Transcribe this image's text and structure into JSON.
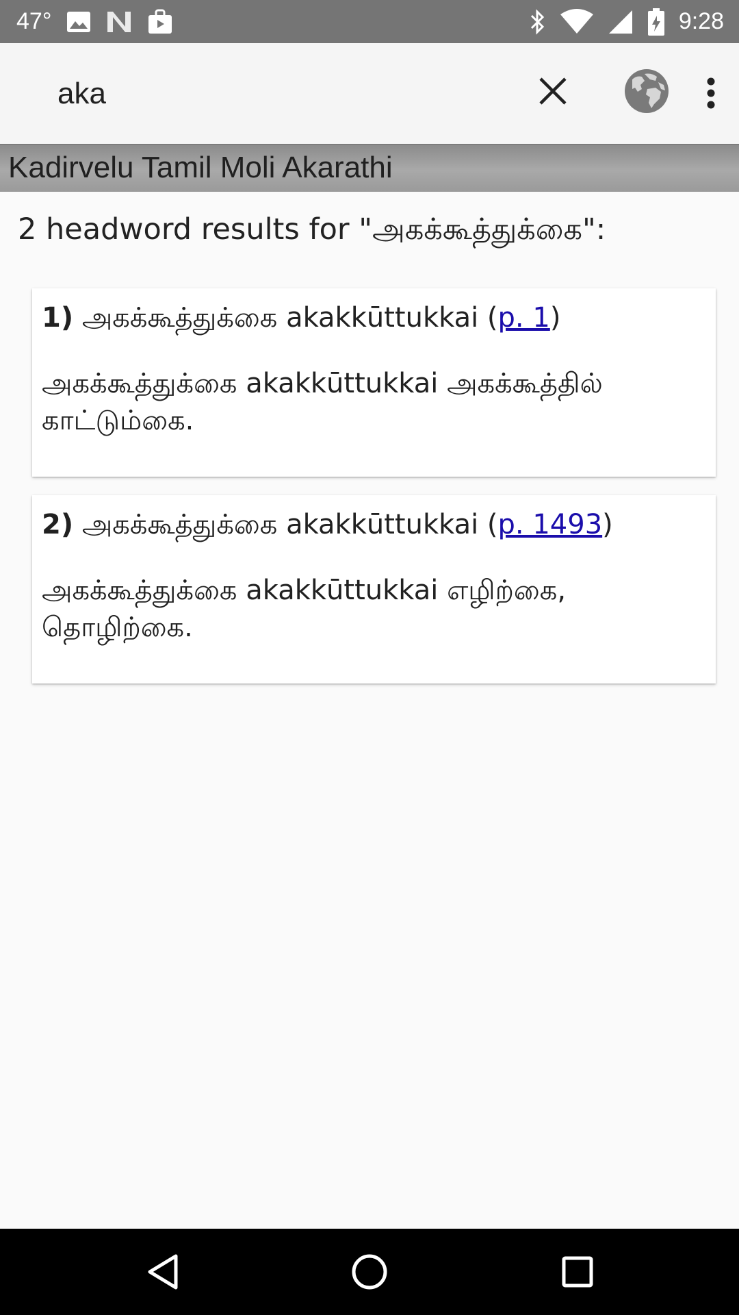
{
  "status_bar": {
    "temperature": "47°",
    "time": "9:28"
  },
  "toolbar": {
    "search_value": "aka",
    "search_placeholder": ""
  },
  "dictionary": {
    "title": "Kadirvelu Tamil Moli Akarathi"
  },
  "results": {
    "summary": "2 headword results for \"அகக்கூத்துக்கை\":",
    "entries": [
      {
        "number": "1)",
        "headword": "அகக்கூத்துக்கை akakkūttukkai (",
        "page_link": "p. 1",
        "close_paren": ")",
        "definition": "அகக்கூத்துக்கை akakkūttukkai அகக்கூத்தில் காட்டும்கை."
      },
      {
        "number": "2)",
        "headword": "அகக்கூத்துக்கை akakkūttukkai (",
        "page_link": "p. 1493",
        "close_paren": ")",
        "definition": "அகக்கூத்துக்கை akakkūttukkai எழிற்கை, தொழிற்கை."
      }
    ]
  },
  "icons": {
    "status": [
      "image-icon",
      "notification-n-icon",
      "shopping-bag-icon",
      "bluetooth-icon",
      "wifi-icon",
      "cell-signal-icon",
      "battery-icon"
    ],
    "toolbar": [
      "close-icon",
      "globe-icon",
      "more-vert-icon"
    ],
    "nav": [
      "back-icon",
      "home-icon",
      "recents-icon"
    ]
  },
  "colors": {
    "status_bar": "#757575",
    "toolbar": "#f5f5f5",
    "link": "#1a0dab",
    "nav_bar": "#000000"
  }
}
